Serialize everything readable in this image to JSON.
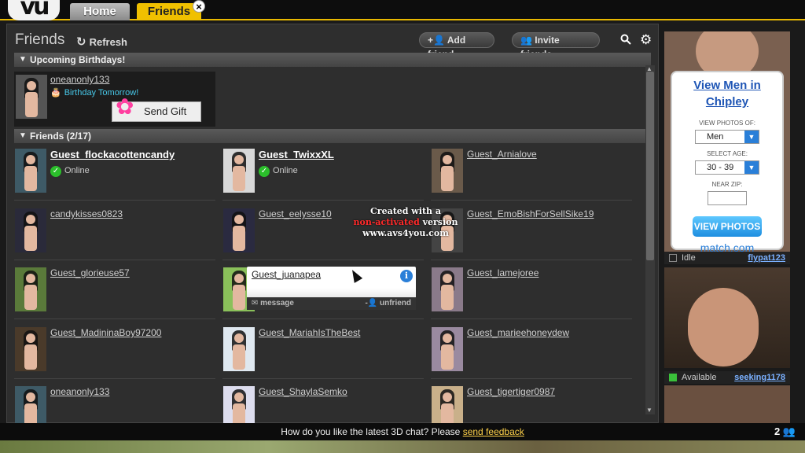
{
  "tabs": {
    "home": "Home",
    "friends": "Friends",
    "close": "×"
  },
  "logo": "vu",
  "header": {
    "title": "Friends",
    "refresh": "Refresh",
    "add_friend": "Add friend",
    "invite_friends": "Invite friends"
  },
  "birthdays": {
    "section": "Upcoming Birthdays!",
    "user": "oneanonly133",
    "note": "Birthday Tomorrow!",
    "send_gift": "Send Gift"
  },
  "friends_section": "Friends (2/17)",
  "friends": [
    {
      "name": "Guest_flockacottencandy",
      "status": "Online",
      "online": true
    },
    {
      "name": "Guest_TwixxXL",
      "status": "Online",
      "online": true
    },
    {
      "name": "Guest_Arnialove"
    },
    {
      "name": "candykisses0823"
    },
    {
      "name": "Guest_eelysse10"
    },
    {
      "name": "Guest_EmoBishForSellSike19"
    },
    {
      "name": "Guest_glorieuse57"
    },
    {
      "name": "Guest_juanapea"
    },
    {
      "name": "Guest_lamejoree"
    },
    {
      "name": "Guest_MadininaBoy97200"
    },
    {
      "name": "Guest_MariahIsTheBest"
    },
    {
      "name": "Guest_marieehoneydew"
    },
    {
      "name": "oneanonly133"
    },
    {
      "name": "Guest_ShaylaSemko"
    },
    {
      "name": "Guest_tigertiger0987"
    }
  ],
  "hover_card": {
    "name": "Guest_juanapea",
    "message": "message",
    "unfriend": "unfriend",
    "info": "i"
  },
  "watermark": {
    "line1": "Created with a",
    "line2_red": "non-activated",
    "line2_rest": "version",
    "line3": "www.avs4you.com"
  },
  "ad": {
    "title": "View Men in Chipley",
    "photos_label": "VIEW PHOTOS OF:",
    "photos_value": "Men",
    "age_label": "SELECT AGE:",
    "age_value": "30 - 39",
    "zip_label": "NEAR ZIP:",
    "button": "VIEW PHOTOS",
    "brand": "match.com"
  },
  "ad_users": [
    {
      "status": "Idle",
      "name": "flypat123"
    },
    {
      "status": "Available",
      "name": "seeking1178"
    }
  ],
  "bottom": {
    "text": "How do you like the latest 3D chat? Please",
    "link": "send feedback",
    "count": "2"
  }
}
